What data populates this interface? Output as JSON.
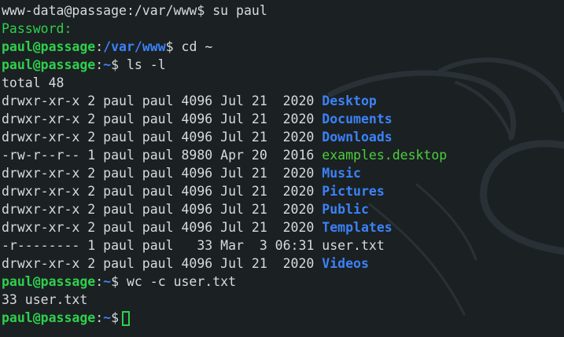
{
  "terminal": {
    "line1": {
      "text": "www-data@passage:/var/www$ su paul"
    },
    "line2": {
      "text": "Password:"
    },
    "line3": {
      "user": "paul@passage",
      "colon": ":",
      "path": "/var/www",
      "dollar": "$",
      "cmd": " cd ~"
    },
    "line4": {
      "user": "paul@passage",
      "colon": ":",
      "path": "~",
      "dollar": "$",
      "cmd": " ls -l"
    },
    "total": "total 48",
    "files": [
      {
        "meta": "drwxr-xr-x 2 paul paul 4096 Jul 21  2020 ",
        "name": "Desktop",
        "type": "dir"
      },
      {
        "meta": "drwxr-xr-x 2 paul paul 4096 Jul 21  2020 ",
        "name": "Documents",
        "type": "dir"
      },
      {
        "meta": "drwxr-xr-x 2 paul paul 4096 Jul 21  2020 ",
        "name": "Downloads",
        "type": "dir"
      },
      {
        "meta": "-rw-r--r-- 1 paul paul 8980 Apr 20  2016 ",
        "name": "examples.desktop",
        "type": "exe"
      },
      {
        "meta": "drwxr-xr-x 2 paul paul 4096 Jul 21  2020 ",
        "name": "Music",
        "type": "dir"
      },
      {
        "meta": "drwxr-xr-x 2 paul paul 4096 Jul 21  2020 ",
        "name": "Pictures",
        "type": "dir"
      },
      {
        "meta": "drwxr-xr-x 2 paul paul 4096 Jul 21  2020 ",
        "name": "Public",
        "type": "dir"
      },
      {
        "meta": "drwxr-xr-x 2 paul paul 4096 Jul 21  2020 ",
        "name": "Templates",
        "type": "dir"
      },
      {
        "meta": "-r-------- 1 paul paul   33 Mar  3 06:31 ",
        "name": "user.txt",
        "type": "exe"
      },
      {
        "meta": "drwxr-xr-x 2 paul paul 4096 Jul 21  2020 ",
        "name": "Videos",
        "type": "dir"
      }
    ],
    "line16": {
      "user": "paul@passage",
      "colon": ":",
      "path": "~",
      "dollar": "$",
      "cmd": " wc -c user.txt"
    },
    "line17": {
      "text": "33 user.txt"
    },
    "line18": {
      "user": "paul@passage",
      "colon": ":",
      "path": "~",
      "dollar": "$"
    }
  },
  "colors": {
    "background": "#1b2023",
    "prompt": "#2fd04c",
    "directory": "#3b82f6",
    "text": "#d7dbdd"
  },
  "icons": {
    "background_logo": "kali-dragon-icon"
  }
}
